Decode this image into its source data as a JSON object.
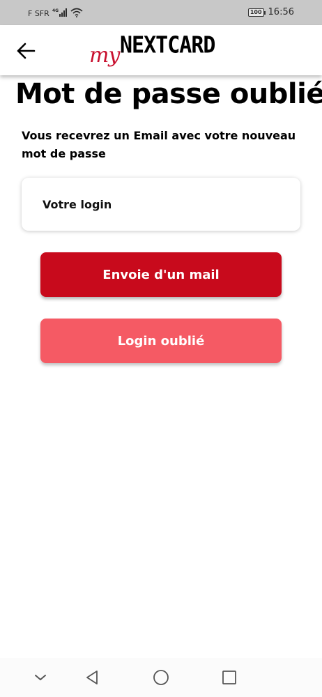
{
  "status_bar": {
    "carrier": "F SFR",
    "network": "4G",
    "battery": "100",
    "time": "16:56"
  },
  "header": {
    "logo_my": "my",
    "logo_brand": "NEXTCARD"
  },
  "page": {
    "title": "Mot de passe oublié",
    "subtitle": "Vous recevrez un Email avec votre nouveau mot de passe"
  },
  "form": {
    "login_placeholder": "Votre login",
    "login_value": ""
  },
  "buttons": {
    "send_mail": "Envoie d'un mail",
    "forgot_login": "Login oublié"
  },
  "colors": {
    "primary": "#c80a1c",
    "secondary": "#f55a64",
    "logo_red": "#c8102e"
  },
  "icons": {
    "back": "arrow-left-icon",
    "nav": [
      "chevron-down-icon",
      "back-triangle-icon",
      "home-circle-icon",
      "recents-square-icon"
    ]
  }
}
